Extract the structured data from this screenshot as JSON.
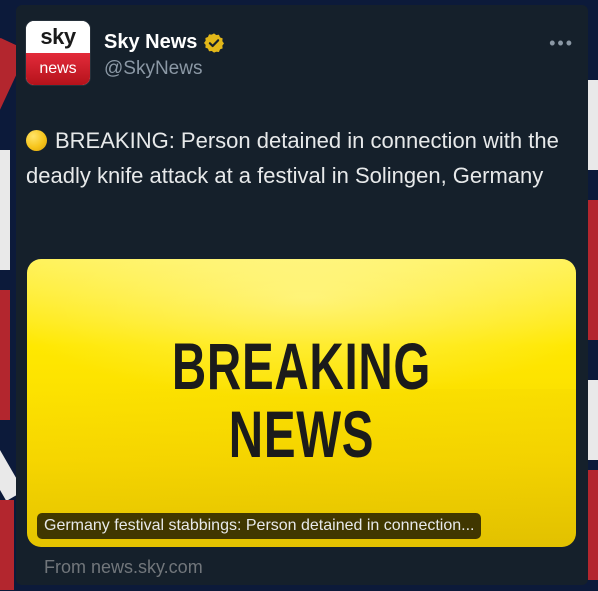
{
  "colors": {
    "card_bg": "#15202b",
    "text_primary": "#e7e9ea",
    "text_secondary": "#8b98a5",
    "verified_gold": "#e2b719",
    "breaking_yellow": "#ffe800",
    "sky_red": "#d61f2b"
  },
  "account": {
    "avatar_top": "sky",
    "avatar_bottom": "news",
    "display_name": "Sky News",
    "verified_icon": "verified-gold-badge-icon",
    "handle": "@SkyNews",
    "more_icon": "more-options-icon"
  },
  "tweet": {
    "emoji_icon": "yellow-circle-icon",
    "text": "BREAKING: Person detained in connection with the deadly knife attack at a festival in Solingen, Germany"
  },
  "media": {
    "headline_line1": "BREAKING",
    "headline_line2": "NEWS",
    "caption": "Germany festival stabbings: Person detained in connection..."
  },
  "link_source": "From news.sky.com"
}
